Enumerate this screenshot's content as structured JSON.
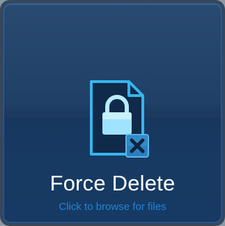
{
  "tile": {
    "title": "Force Delete",
    "subtitle": "Click to browse for files",
    "icon": "locked-file-delete-icon"
  },
  "colors": {
    "tile_background": "#17365d",
    "title": "#ffffff",
    "subtitle": "#1f84d6",
    "icon_accent": "#38b8ef"
  }
}
